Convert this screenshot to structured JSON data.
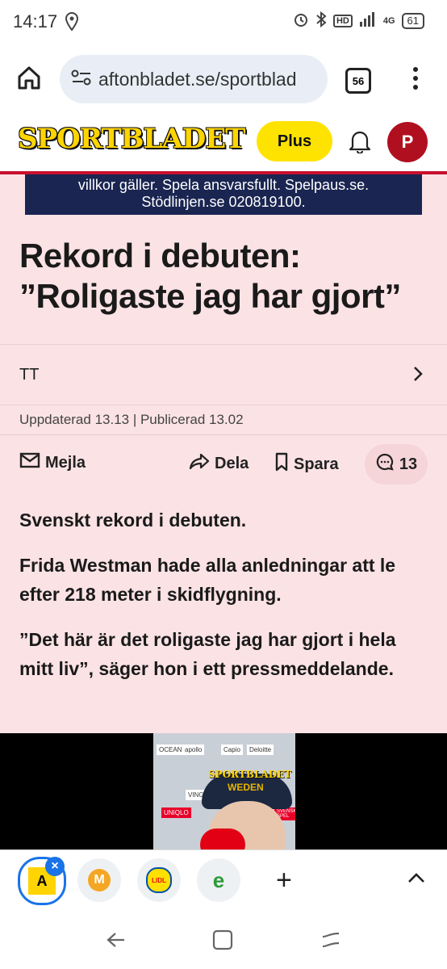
{
  "status_bar": {
    "time": "14:17",
    "battery": "61",
    "icons": [
      "location-icon",
      "alarm-icon",
      "bluetooth-icon",
      "hd-icon",
      "signal-icon",
      "network-4g-icon",
      "battery-icon"
    ],
    "hd": "HD",
    "net": "4G"
  },
  "browser": {
    "url": "aftonbladet.se/sportblad",
    "tab_count": "56"
  },
  "site_header": {
    "logo": "SPORTBLADET",
    "plus_label": "Plus",
    "avatar_letter": "P"
  },
  "ad_banner": {
    "line1": "villkor gäller. Spela ansvarsfullt. Spelpaus.se.",
    "line2": "Stödlinjen.se 020819100."
  },
  "article": {
    "headline": "Rekord i debuten: ”Roligaste jag har gjort”",
    "author": "TT",
    "dates": "Uppdaterad 13.13 | Publicerad 13.02",
    "actions": {
      "mail": "Mejla",
      "share": "Dela",
      "save": "Spara",
      "comments": "13"
    },
    "paragraphs": [
      "Svenskt rekord i debuten.",
      "Frida Westman hade alla anledningar att le efter 218 meter i skidflygning.",
      "”Det här är det roligaste jag har gjort i hela mitt liv”, säger hon i ett pressmeddelande."
    ]
  },
  "video": {
    "overlay_logo": "SPORTBLADET",
    "sponsors": [
      "OCEAN",
      "apollo",
      "Capio",
      "Deloitte",
      "VINGE",
      "UNIQLO",
      "SVENSKA SPEL"
    ],
    "hat_text": "WEDEN"
  },
  "bottom_bar": {
    "shortcut_letters": [
      "A",
      "M",
      "LIDL",
      "e"
    ],
    "add_label": "+"
  },
  "colors": {
    "brand_yellow": "#ffd400",
    "brand_red": "#c8102e",
    "article_bg": "#fbe2e5",
    "ad_bg": "#1a2551"
  }
}
